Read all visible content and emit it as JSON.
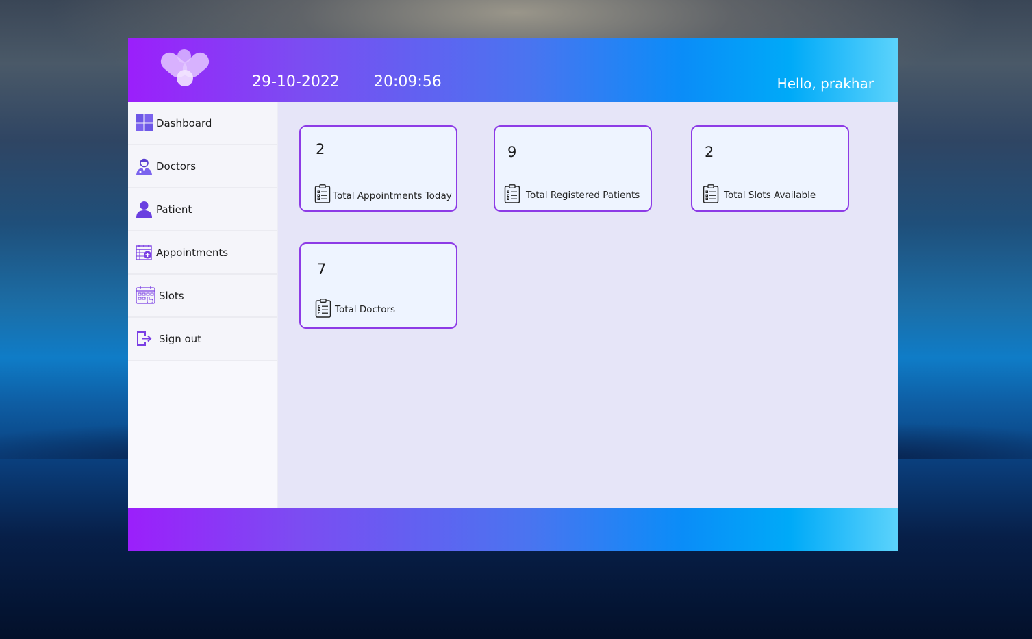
{
  "header": {
    "date": "29-10-2022",
    "time": "20:09:56",
    "greeting": "Hello, prakhar"
  },
  "sidebar": {
    "items": [
      {
        "label": "Dashboard",
        "icon": "dashboard-grid-icon"
      },
      {
        "label": "Doctors",
        "icon": "doctor-icon"
      },
      {
        "label": "Patient",
        "icon": "person-icon"
      },
      {
        "label": "Appointments",
        "icon": "calendar-plus-icon"
      },
      {
        "label": "Slots",
        "icon": "calendar-grid-icon"
      },
      {
        "label": "Sign out",
        "icon": "sign-out-icon"
      }
    ]
  },
  "cards": [
    {
      "value": "2",
      "label": "Total Appointments Today",
      "icon": "clipboard-list-icon"
    },
    {
      "value": "9",
      "label": "Total Registered Patients",
      "icon": "clipboard-list-icon"
    },
    {
      "value": "2",
      "label": "Total Slots Available",
      "icon": "clipboard-list-icon"
    },
    {
      "value": "7",
      "label": "Total Doctors",
      "icon": "clipboard-list-icon"
    }
  ],
  "colors": {
    "accent": "#8d3be6",
    "gradient_start": "#9b1ffb",
    "gradient_end": "#5cd3fb",
    "icon_purple": "#7b3fe4",
    "content_bg": "#e6e5f8"
  }
}
